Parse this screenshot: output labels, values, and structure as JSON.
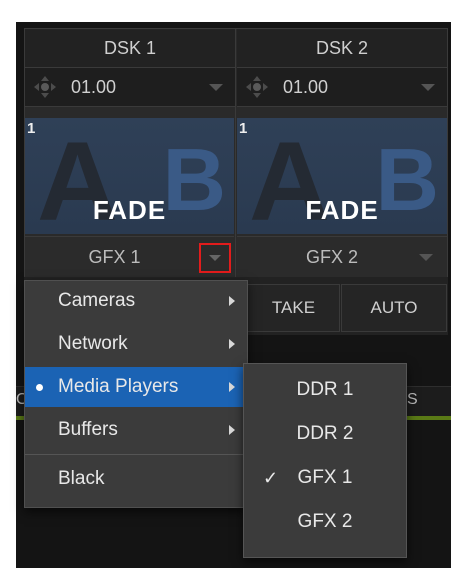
{
  "dsk": [
    {
      "header": "DSK 1",
      "time": "01.00",
      "slot_number": "1",
      "letter_a": "A",
      "letter_b": "B",
      "transition": "FADE",
      "source": "GFX 1"
    },
    {
      "header": "DSK 2",
      "time": "01.00",
      "slot_number": "1",
      "letter_a": "A",
      "letter_b": "B",
      "transition": "FADE",
      "source": "GFX 2"
    }
  ],
  "buttons": {
    "take": "TAKE",
    "auto": "AUTO"
  },
  "background_tabs": {
    "left_fragment": "OF",
    "right_fragment": "S"
  },
  "source_menu": {
    "items": [
      {
        "label": "Cameras",
        "has_submenu": true
      },
      {
        "label": "Network",
        "has_submenu": true
      },
      {
        "label": "Media Players",
        "has_submenu": true,
        "active": true
      },
      {
        "label": "Buffers",
        "has_submenu": true
      },
      {
        "label": "Black",
        "has_submenu": false
      }
    ]
  },
  "media_players_submenu": {
    "items": [
      {
        "label": "DDR 1",
        "checked": false
      },
      {
        "label": "DDR 2",
        "checked": false
      },
      {
        "label": "GFX 1",
        "checked": true,
        "check_mark": "✓"
      },
      {
        "label": "GFX 2",
        "checked": false
      }
    ]
  },
  "colors": {
    "active_menu": "#1b63b4",
    "highlight_border": "#e21c1c",
    "status_bar": "#5a7a16"
  },
  "icons": [
    "move-icon",
    "dropdown-arrow-icon",
    "submenu-arrow-icon",
    "checkmark-icon",
    "bullet-icon"
  ]
}
